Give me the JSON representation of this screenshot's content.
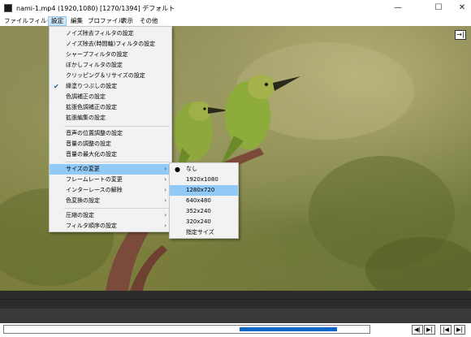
{
  "window": {
    "title": "nami-1.mp4 (1920,1080)  [1270/1394]  デフォルト",
    "minimize": "—",
    "maximize": "☐",
    "close": "✕"
  },
  "menubar": {
    "items": [
      "ファイル",
      "フィルタ",
      "設定",
      "編集",
      "プロファイル",
      "表示",
      "その他"
    ],
    "active": "設定"
  },
  "settings_menu": {
    "items": [
      {
        "label": "ノイズ除去フィルタの設定",
        "checked": false,
        "submenu": false
      },
      {
        "label": "ノイズ除去(時間軸)フィルタの設定",
        "checked": false,
        "submenu": false
      },
      {
        "label": "シャープフィルタの設定",
        "checked": false,
        "submenu": false
      },
      {
        "label": "ぼかしフィルタの設定",
        "checked": false,
        "submenu": false
      },
      {
        "label": "クリッピング＆リサイズの設定",
        "checked": false,
        "submenu": false
      },
      {
        "label": "縁塗りつぶしの設定",
        "checked": true,
        "submenu": false
      },
      {
        "label": "色調補正の設定",
        "checked": false,
        "submenu": false
      },
      {
        "label": "拡張色調補正の設定",
        "checked": false,
        "submenu": false
      },
      {
        "label": "拡張編集の設定",
        "checked": false,
        "submenu": false
      },
      {
        "label": "音声の位置調整の設定",
        "checked": false,
        "submenu": false
      },
      {
        "label": "音量の調整の設定",
        "checked": false,
        "submenu": false
      },
      {
        "label": "音量の最大化の設定",
        "checked": false,
        "submenu": false
      },
      {
        "label": "サイズの変更",
        "checked": false,
        "submenu": true,
        "highlighted": true
      },
      {
        "label": "フレームレートの変更",
        "checked": false,
        "submenu": true
      },
      {
        "label": "インターレースの解除",
        "checked": false,
        "submenu": true
      },
      {
        "label": "色変換の設定",
        "checked": false,
        "submenu": true
      },
      {
        "label": "圧縮の設定",
        "checked": false,
        "submenu": true
      },
      {
        "label": "フィルタ順序の設定",
        "checked": false,
        "submenu": true
      }
    ]
  },
  "size_submenu": {
    "items": [
      {
        "label": "なし",
        "selected": true
      },
      {
        "label": "1920x1080",
        "selected": false
      },
      {
        "label": "1280x720",
        "selected": false,
        "highlighted": true
      },
      {
        "label": "640x480",
        "selected": false
      },
      {
        "label": "352x240",
        "selected": false
      },
      {
        "label": "320x240",
        "selected": false
      },
      {
        "label": "指定サイズ",
        "selected": false
      }
    ]
  },
  "icons": {
    "exit_fullscreen": "→|",
    "check": "✔",
    "bullet": "●",
    "submenu_arrow": "›"
  },
  "playback": {
    "position_frame": 1270,
    "total_frames": 1394,
    "controls": [
      "◀|",
      "▶|",
      "|◀",
      "▶|"
    ]
  },
  "colors": {
    "menu_highlight": "#91c9f7",
    "active_menu": "#cce4f7",
    "seek_fill": "#0a67c9"
  }
}
